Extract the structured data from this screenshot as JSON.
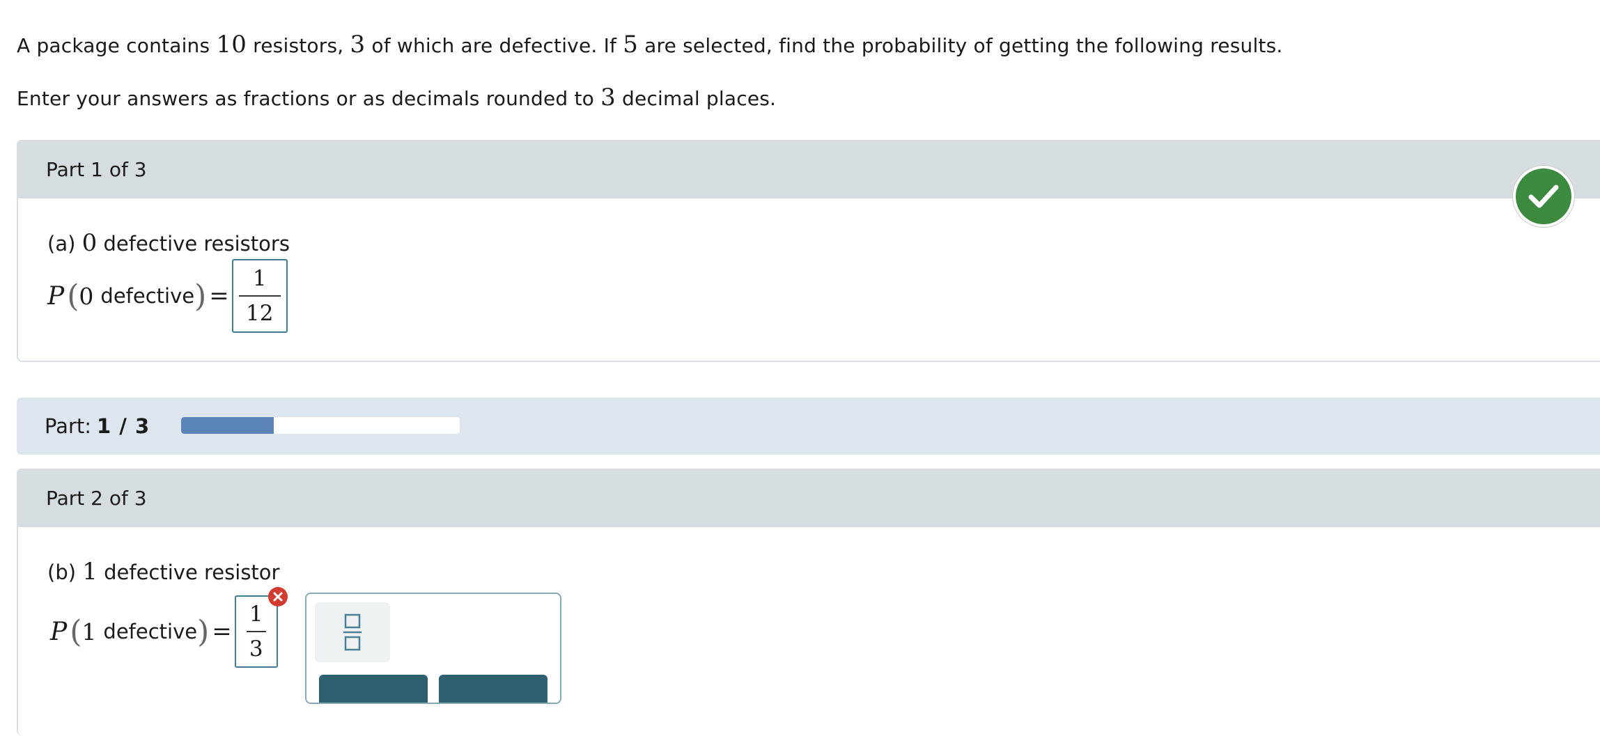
{
  "intro": {
    "line1_a": "A package contains ",
    "line1_n1": "10",
    "line1_b": " resistors, ",
    "line1_n2": "3",
    "line1_c": " of which are defective. If ",
    "line1_n3": "5",
    "line1_d": " are selected, find the probability of getting the following results.",
    "line2_a": "Enter your answers as fractions or as decimals rounded to ",
    "line2_n": "3",
    "line2_b": " decimal places."
  },
  "part1": {
    "header": "Part 1 of 3",
    "question_prefix": "(a) ",
    "question_num": "0",
    "question_text": " defective resistors",
    "eq_P": "P",
    "eq_open": "(",
    "eq_digit": "0",
    "eq_word": "defective",
    "eq_close": ")",
    "eq_equals": "=",
    "answer_numerator": "1",
    "answer_denominator": "12",
    "status": "correct",
    "status_color": "#3b8a3f"
  },
  "progress": {
    "label": "Part:",
    "value": "1 / 3",
    "fraction": 0.333,
    "fill_color": "#5a84b8"
  },
  "part2": {
    "header": "Part 2 of 3",
    "question_prefix": "(b) ",
    "question_num": "1",
    "question_text": " defective resistor",
    "eq_P": "P",
    "eq_open": "(",
    "eq_digit": "1",
    "eq_word": "defective",
    "eq_close": ")",
    "eq_equals": "=",
    "answer_numerator": "1",
    "answer_denominator": "3",
    "status": "incorrect",
    "status_color": "#d23b30"
  },
  "palette": {
    "fraction_icon": "fraction-template-icon"
  },
  "colors": {
    "header_bg": "#d5dde1",
    "progress_strip_bg": "#dde6ef",
    "input_border": "#3f7d96",
    "toolbar_button": "#2f6070"
  }
}
